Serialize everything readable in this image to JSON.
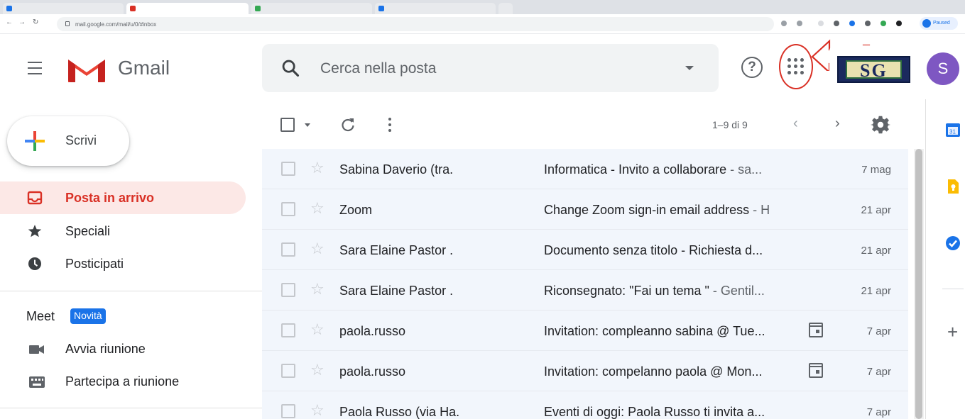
{
  "browser": {
    "url": "mail.google.com/mail/u/0/#inbox",
    "profile_label": "Paused"
  },
  "header": {
    "brand": "Gmail",
    "search_placeholder": "Cerca nella posta",
    "org_logo_text": "SG",
    "avatar_initial": "S"
  },
  "sidebar": {
    "compose_label": "Scrivi",
    "items": [
      {
        "label": "Posta in arrivo",
        "icon": "inbox-icon",
        "active": true
      },
      {
        "label": "Speciali",
        "icon": "star-icon"
      },
      {
        "label": "Posticipati",
        "icon": "clock-icon"
      }
    ],
    "meet": {
      "title": "Meet",
      "badge": "Novità",
      "items": [
        {
          "label": "Avvia riunione",
          "icon": "videocam-icon"
        },
        {
          "label": "Partecipa a riunione",
          "icon": "keyboard-icon"
        }
      ]
    }
  },
  "toolbar": {
    "pagination": "1–9 di 9"
  },
  "emails": [
    {
      "sender": "Sabina Daverio (tra.",
      "subject": "Informatica - Invito a collaborare",
      "snippet": " - sa...",
      "date": "7 mag",
      "has_event": false
    },
    {
      "sender": "Zoom",
      "subject": "Change Zoom sign-in email address",
      "snippet": " - H",
      "date": "21 apr",
      "has_event": false
    },
    {
      "sender": "Sara Elaine Pastor .",
      "subject": "Documento senza titolo - Richiesta d...",
      "snippet": "",
      "date": "21 apr",
      "has_event": false
    },
    {
      "sender": "Sara Elaine Pastor .",
      "subject": "Riconsegnato: \"Fai un tema \"",
      "snippet": " - Gentil...",
      "date": "21 apr",
      "has_event": false
    },
    {
      "sender": "paola.russo",
      "subject": "Invitation: compleanno sabina @ Tue...",
      "snippet": "",
      "date": "7 apr",
      "has_event": true
    },
    {
      "sender": "paola.russo",
      "subject": "Invitation: compelanno paola @ Mon...",
      "snippet": "",
      "date": "7 apr",
      "has_event": true
    },
    {
      "sender": "Paola Russo (via Ha.",
      "subject": "Eventi di oggi: Paola Russo ti invita a...",
      "snippet": "",
      "date": "7 apr",
      "has_event": false
    }
  ],
  "colors": {
    "accent_red": "#d93025",
    "active_bg": "#fce8e6",
    "badge_blue": "#1a73e8",
    "avatar_purple": "#7e57c2",
    "row_bg": "#f2f6fc"
  }
}
